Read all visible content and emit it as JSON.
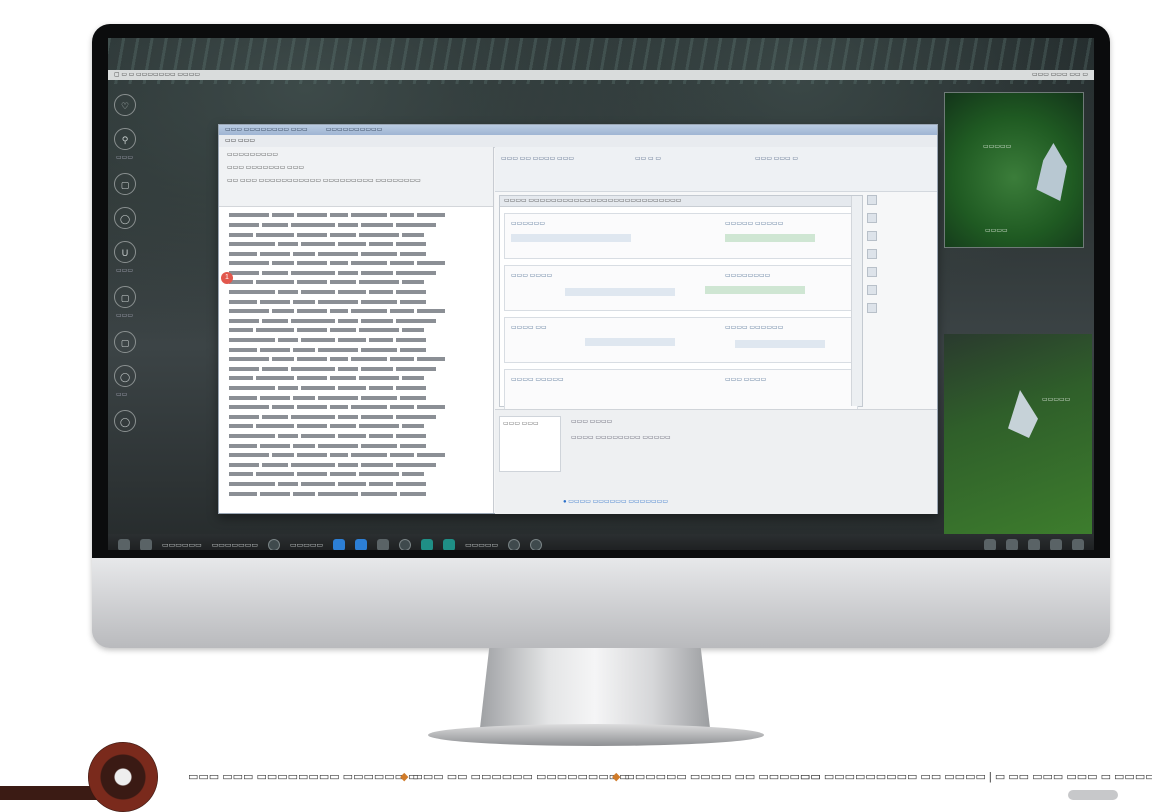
{
  "screen": {
    "menubar": {
      "left": "▢ ▭ ▭ ▭▭▭▭▭▭▭ ▭▭▭▭",
      "right": "▭▭▭ ▭▭▭ ▭▭ ▭"
    },
    "side_icons": [
      "♡",
      "⚲",
      "▢",
      "◯",
      "U",
      "▢",
      "▢",
      "◯",
      "◯"
    ],
    "side_labels": [
      "▭▭▭",
      "▭▭▭",
      "▭▭▭",
      "▭▭"
    ]
  },
  "app": {
    "title": "▭▭▭ ▭▭▭▭▭▭▭▭ ▭▭▭",
    "title_right": "▭▭▭▭▭▭▭▭▭▭",
    "toolbar": "▭▭ ▭▭▭",
    "doc_head": [
      "▭▭▭▭▭▭▭▭▭",
      "▭▭▭ ▭▭▭▭▭▭▭ ▭▭▭",
      "▭▭ ▭▭▭ ▭▭▭▭▭▭▭▭▭▭▭ ▭▭▭▭▭▭▭▭▭ ▭▭▭▭▭▭▭▭"
    ],
    "badge": "1",
    "right_toolbar": [
      "▭▭▭ ▭▭ ▭▭▭▭ ▭▭▭",
      "▭▭ ▭ ▭",
      "▭▭▭ ▭▭▭ ▭"
    ],
    "grid_head": "▭▭▭▭ ▭▭▭▭▭▭▭▭▭▭▭▭▭▭▭▭▭▭▭▭▭▭▭▭▭▭▭",
    "grid_rows": [
      {
        "a": "▭▭▭▭▭▭",
        "b": "▭▭▭▭▭ ▭▭▭▭▭"
      },
      {
        "a": "▭▭▭ ▭▭▭▭",
        "b": "▭▭▭▭▭▭▭▭"
      },
      {
        "a": "▭▭▭▭ ▭▭",
        "b": "▭▭▭▭ ▭▭▭▭▭▭"
      },
      {
        "a": "▭▭▭▭ ▭▭▭▭▭",
        "b": "▭▭▭ ▭▭▭▭"
      }
    ],
    "lower_tab": "▭▭▭ ▭▭▭",
    "lower_title": "▭▭▭ ▭▭▭▭",
    "lower_desc": "▭▭▭▭ ▭▭▭▭▭▭▭▭ ▭▭▭▭▭",
    "lower_link": "● ▭▭▭▭ ▭▭▭▭▭▭ ▭▭▭▭▭▭▭"
  },
  "widgets": {
    "w1_top": "▭▭▭▭▭",
    "w1_bottom": "▭▭▭▭",
    "w2_label": "▭▭▭▭▭"
  },
  "taskbar": {
    "items": [
      "▭▭▭▭▭▭",
      "▭▭▭▭▭▭▭",
      "▭▭▭▭▭",
      "▭▭▭▭▭"
    ]
  },
  "bottom": {
    "col1": "▭▭▭ ▭▭▭ ▭▭▭▭▭▭▭▭ ▭▭▭▭▭▭ ▭",
    "col2": "▭▭▭ ▭▭ ▭▭▭▭▭▭ ▭▭▭▭▭▭▭▭▭",
    "col3": "▭▭▭▭▭▭ ▭▭▭▭ ▭▭ ▭▭▭▭▭▭",
    "col4": "▭▭ ▭▭▭▭▭▭▭▭▭ ▭▭ ▭▭▭▭ | ▭ ▭▭ ▭▭▭ ▭▭▭ ▭ ▭▭▭▭ ▭▭▭▭"
  },
  "colors": {
    "accent": "#2c7fd6",
    "badge": "#e2574c",
    "bullet": "#d07b2a"
  }
}
